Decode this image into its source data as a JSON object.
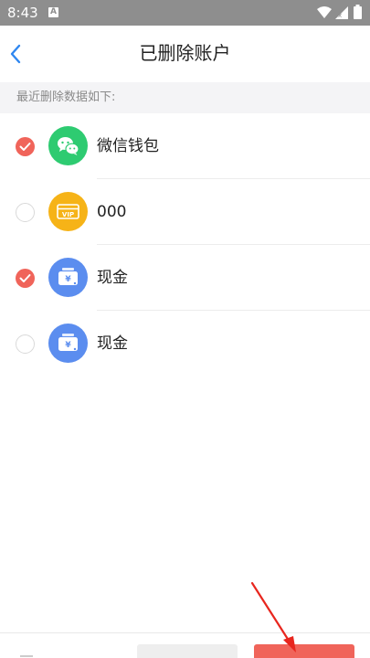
{
  "status_bar": {
    "time": "8:43",
    "notification_icon": "A"
  },
  "header": {
    "title": "已删除账户",
    "back_icon": "chevron-left-icon"
  },
  "section_label": "最近删除数据如下:",
  "accounts": [
    {
      "name": "微信钱包",
      "checked": true,
      "icon": "wechat-icon",
      "icon_color": "#2ecb71"
    },
    {
      "name": "000",
      "checked": false,
      "icon": "vip-card-icon",
      "icon_color": "#f6b317"
    },
    {
      "name": "现金",
      "checked": true,
      "icon": "cash-wallet-icon",
      "icon_color": "#5b8def"
    },
    {
      "name": "现金",
      "checked": false,
      "icon": "cash-wallet-icon",
      "icon_color": "#5b8def"
    }
  ],
  "colors": {
    "accent_red": "#f0645a",
    "back_blue": "#2f87f0"
  }
}
